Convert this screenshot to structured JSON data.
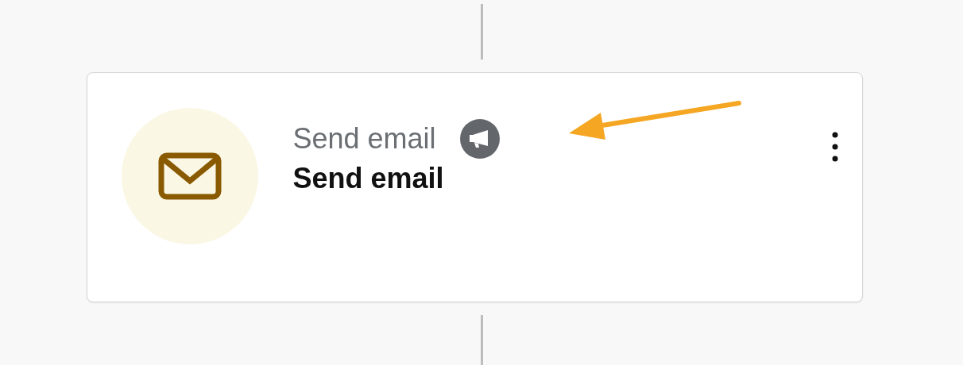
{
  "step": {
    "type_label": "Send email",
    "title": "Send email"
  }
}
